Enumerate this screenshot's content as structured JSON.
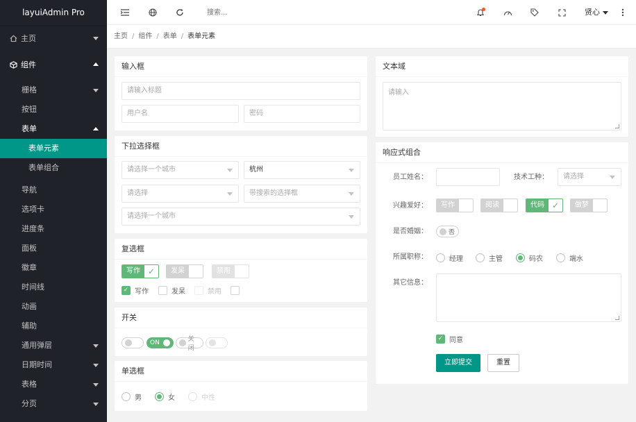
{
  "app": {
    "title": "layuiAdmin Pro"
  },
  "sidebar": {
    "home": "主页",
    "components": "组件",
    "items": [
      "栅格",
      "按钮",
      "表单",
      "导航",
      "选项卡",
      "进度条",
      "面板",
      "徽章",
      "时间线",
      "动画",
      "辅助",
      "通用弹层",
      "日期时间",
      "表格",
      "分页"
    ],
    "form_children": [
      "表单元素",
      "表单组合"
    ]
  },
  "topbar": {
    "search_placeholder": "搜索...",
    "user": "贤心",
    "icons": [
      "menu-fold-icon",
      "globe-icon",
      "refresh-icon",
      "bell-icon",
      "dashboard-icon",
      "tag-icon",
      "fullscreen-icon",
      "more-icon"
    ]
  },
  "breadcrumb": [
    "主页",
    "组件",
    "表单",
    "表单元素"
  ],
  "cards": {
    "input": {
      "title": "输入框",
      "title_placeholder": "请输入标题",
      "username_placeholder": "用户名",
      "password_placeholder": "密码"
    },
    "select": {
      "title": "下拉选择框",
      "city_placeholder": "请选择一个城市",
      "city_value": "杭州",
      "select_placeholder": "请选择",
      "search_select_placeholder": "带搜索的选择框",
      "city_placeholder2": "请选择一个城市"
    },
    "checkbox": {
      "title": "复选框",
      "tags": [
        "写作",
        "发呆",
        "禁用"
      ],
      "primary": [
        "写作",
        "发呆",
        "禁用"
      ]
    },
    "switch": {
      "title": "开关",
      "on": "ON",
      "off": "关闭"
    },
    "radio": {
      "title": "单选框",
      "options": [
        "男",
        "女",
        "中性"
      ]
    },
    "textarea": {
      "title": "文本域",
      "placeholder": "请输入"
    },
    "combo": {
      "title": "响应式组合",
      "name_label": "员工姓名：",
      "skill_label": "技术工种：",
      "skill_placeholder": "请选择",
      "hobby_label": "兴趣爱好：",
      "hobbies": [
        "写作",
        "阅读",
        "代码",
        "做梦"
      ],
      "married_label": "是否婚姻：",
      "married_value": "否",
      "role_label": "所属职称：",
      "roles": [
        "经理",
        "主管",
        "码农",
        "端水"
      ],
      "other_label": "其它信息：",
      "agree": "同意",
      "submit": "立即提交",
      "reset": "重置"
    }
  }
}
